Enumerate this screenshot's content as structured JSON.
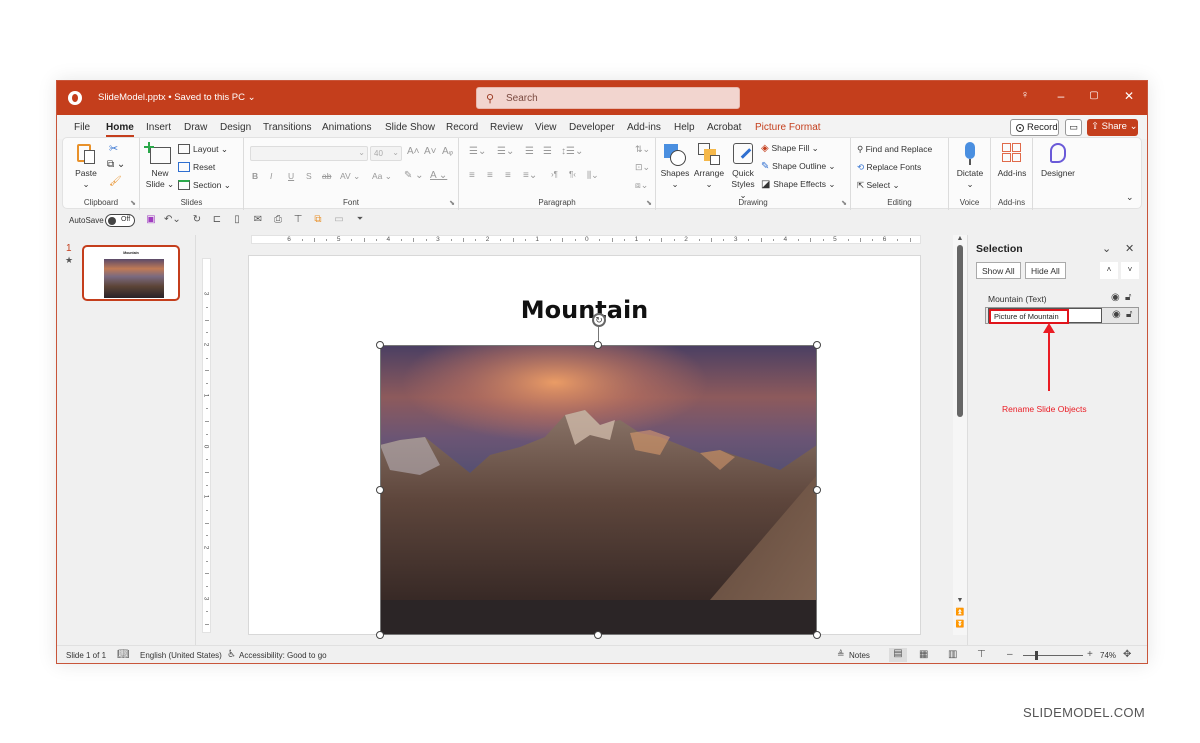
{
  "titlebar": {
    "doc_title": "SlideModel.pptx • Saved to this PC ⌄",
    "search_placeholder": "Search",
    "icons": {
      "app": "powerpoint-logo-icon",
      "search": "search-icon",
      "lightbulb": "lightbulb-icon",
      "minimize": "minimize-icon",
      "maximize": "maximize-icon",
      "close": "close-icon"
    }
  },
  "tabs": [
    {
      "label": "File"
    },
    {
      "label": "Home",
      "active": true
    },
    {
      "label": "Insert"
    },
    {
      "label": "Draw"
    },
    {
      "label": "Design"
    },
    {
      "label": "Transitions"
    },
    {
      "label": "Animations"
    },
    {
      "label": "Slide Show"
    },
    {
      "label": "Record"
    },
    {
      "label": "Review"
    },
    {
      "label": "View"
    },
    {
      "label": "Developer"
    },
    {
      "label": "Add-ins"
    },
    {
      "label": "Help"
    },
    {
      "label": "Acrobat"
    },
    {
      "label": "Picture Format",
      "contextual": true
    }
  ],
  "tab_actions": {
    "record": "Record",
    "share": "Share ⌄"
  },
  "ribbon": {
    "clipboard": {
      "label": "Clipboard",
      "paste": "Paste",
      "paste_caret": "⌄"
    },
    "slides": {
      "label": "Slides",
      "new_slide_1": "New",
      "new_slide_2": "Slide ⌄",
      "layout": "Layout ⌄",
      "reset": "Reset",
      "section": "Section ⌄"
    },
    "font": {
      "label": "Font",
      "font_name": "",
      "font_size": "40",
      "bold": "B",
      "italic": "I",
      "underline": "U",
      "strike": "S",
      "aa": "Aa ⌄",
      "av": "AV ⌄",
      "grow": "A˄",
      "shrink": "A˅"
    },
    "paragraph": {
      "label": "Paragraph"
    },
    "drawing": {
      "label": "Drawing",
      "shapes": "Shapes",
      "arrange": "Arrange",
      "quick_styles_1": "Quick",
      "quick_styles_2": "Styles ⌄",
      "shape_fill": "Shape Fill ⌄",
      "shape_outline": "Shape Outline ⌄",
      "shape_effects": "Shape Effects ⌄"
    },
    "editing": {
      "label": "Editing",
      "find_replace": "Find and Replace",
      "replace_fonts": "Replace Fonts",
      "select": "Select ⌄"
    },
    "voice": {
      "label": "Voice",
      "dictate": "Dictate"
    },
    "addins": {
      "label": "Add-ins",
      "addins": "Add-ins"
    },
    "designer": {
      "designer": "Designer"
    }
  },
  "qat": {
    "autosave_label": "AutoSave",
    "autosave_state": "Off"
  },
  "thumbnails": [
    {
      "number": "1",
      "title": "Mountain"
    }
  ],
  "rulers": {
    "horizontal": [
      "6",
      "5",
      "4",
      "3",
      "2",
      "1",
      "0",
      "1",
      "2",
      "3",
      "4",
      "5",
      "6"
    ],
    "vertical": [
      "3",
      "2",
      "1",
      "0",
      "1",
      "2",
      "3"
    ]
  },
  "slide": {
    "title": "Mountain",
    "picture_alt": "Mountain range at sunset"
  },
  "selection_pane": {
    "title": "Selection",
    "show_all": "Show All",
    "hide_all": "Hide All",
    "objects": [
      {
        "name": "Mountain (Text)",
        "visible": true,
        "locked": false
      },
      {
        "name": "Picture of Mountain",
        "visible": true,
        "locked": false,
        "editing": true
      }
    ],
    "annotation": "Rename Slide Objects",
    "annotation_color": "#ea1c24"
  },
  "statusbar": {
    "slide_count": "Slide 1 of 1",
    "language": "English (United States)",
    "accessibility": "Accessibility: Good to go",
    "notes": "Notes",
    "zoom": "74%"
  },
  "watermark": "SLIDEMODEL.COM",
  "colors": {
    "accent": "#c43e1c",
    "annotation": "#ea1c24"
  }
}
